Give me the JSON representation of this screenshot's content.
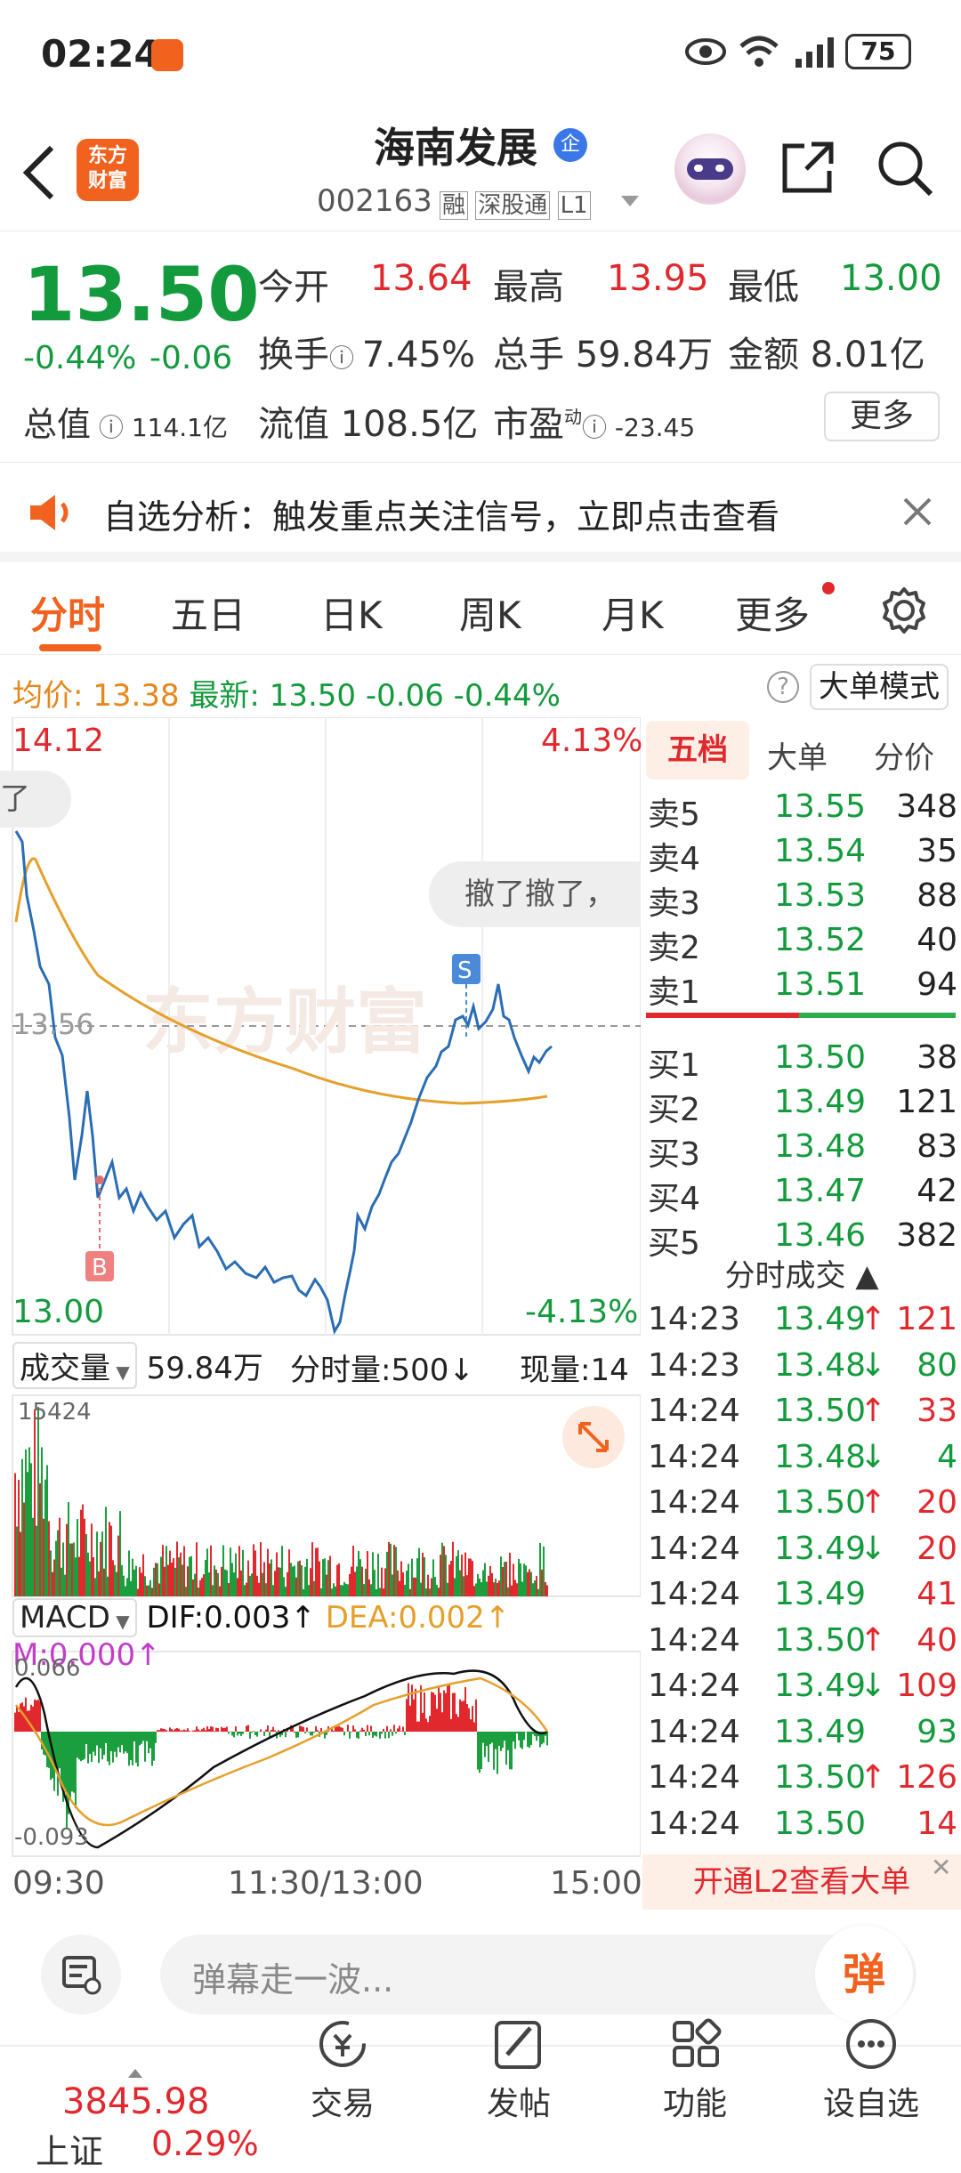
{
  "status": {
    "time": "02:24",
    "battery": "75"
  },
  "header": {
    "title": "海南发展",
    "badge": "企",
    "code": "002163",
    "tags": [
      "融",
      "深股通",
      "L1"
    ],
    "logo_top": "东方",
    "logo_bottom": "财富"
  },
  "quote": {
    "price": "13.50",
    "pct": "-0.44%",
    "chg": "-0.06",
    "open_label": "今开",
    "open": "13.64",
    "high_label": "最高",
    "high": "13.95",
    "low_label": "最低",
    "low": "13.00",
    "turnover_label": "换手",
    "turnover": "7.45%",
    "volume_label": "总手",
    "volume": "59.84万",
    "amount_label": "金额",
    "amount": "8.01亿",
    "mcap_label": "总值",
    "mcap": "114.1亿",
    "float_label": "流值",
    "float": "108.5亿",
    "pe_label": "市盈",
    "pe_sup": "动",
    "pe": "-23.45",
    "more": "更多"
  },
  "banner": {
    "text": "自选分析：触发重点关注信号，立即点击查看"
  },
  "tabs": [
    "分时",
    "五日",
    "日K",
    "周K",
    "月K",
    "更多"
  ],
  "avg": {
    "label_avg": "均价:",
    "avg": "13.38",
    "label_latest": "最新:",
    "latest": "13.50",
    "chg": "-0.06",
    "pct": "-0.44%",
    "mode": "大单模式"
  },
  "chart": {
    "y_top": "14.12",
    "y_bottom": "13.00",
    "pct_top": "4.13%",
    "pct_bottom": "-4.13%",
    "mid": "13.56",
    "watermark": "东方财富",
    "bubble1": "了",
    "bubble2": "撤了撤了，",
    "marker_s": "S",
    "marker_b": "B",
    "vol_label": "成交量",
    "vol_total": "59.84万",
    "vol_period": "分时量:500↓",
    "vol_now": "现量:14",
    "vol_max": "15424",
    "macd_label": "MACD",
    "dif": "DIF:0.003↑",
    "dea": "DEA:0.002↑",
    "m": "M:0.000↑",
    "macd_top": "0.066",
    "macd_bottom": "-0.093",
    "t1": "09:30",
    "t2": "11:30/13:00",
    "t3": "15:00"
  },
  "book": {
    "tabs": [
      "五档",
      "大单",
      "分价"
    ],
    "asks": [
      {
        "l": "卖5",
        "p": "13.55",
        "v": "348"
      },
      {
        "l": "卖4",
        "p": "13.54",
        "v": "35"
      },
      {
        "l": "卖3",
        "p": "13.53",
        "v": "88"
      },
      {
        "l": "卖2",
        "p": "13.52",
        "v": "40"
      },
      {
        "l": "卖1",
        "p": "13.51",
        "v": "94"
      }
    ],
    "bids": [
      {
        "l": "买1",
        "p": "13.50",
        "v": "38"
      },
      {
        "l": "买2",
        "p": "13.49",
        "v": "121"
      },
      {
        "l": "买3",
        "p": "13.48",
        "v": "83"
      },
      {
        "l": "买4",
        "p": "13.47",
        "v": "42"
      },
      {
        "l": "买5",
        "p": "13.46",
        "v": "382"
      }
    ],
    "trades_title": "分时成交",
    "trades": [
      {
        "t": "14:23",
        "p": "13.49",
        "d": "↑",
        "v": "121",
        "c": "r"
      },
      {
        "t": "14:23",
        "p": "13.48",
        "d": "↓",
        "v": "80",
        "c": "g"
      },
      {
        "t": "14:24",
        "p": "13.50",
        "d": "↑",
        "v": "33",
        "c": "r"
      },
      {
        "t": "14:24",
        "p": "13.48",
        "d": "↓",
        "v": "4",
        "c": "g"
      },
      {
        "t": "14:24",
        "p": "13.50",
        "d": "↑",
        "v": "20",
        "c": "r"
      },
      {
        "t": "14:24",
        "p": "13.49",
        "d": "↓",
        "v": "20",
        "c": "r"
      },
      {
        "t": "14:24",
        "p": "13.49",
        "d": "",
        "v": "41",
        "c": "r"
      },
      {
        "t": "14:24",
        "p": "13.50",
        "d": "↑",
        "v": "40",
        "c": "r"
      },
      {
        "t": "14:24",
        "p": "13.49",
        "d": "↓",
        "v": "109",
        "c": "r"
      },
      {
        "t": "14:24",
        "p": "13.49",
        "d": "",
        "v": "93",
        "c": "g"
      },
      {
        "t": "14:24",
        "p": "13.50",
        "d": "↑",
        "v": "126",
        "c": "r"
      },
      {
        "t": "14:24",
        "p": "13.50",
        "d": "",
        "v": "14",
        "c": "r"
      }
    ],
    "l2": "开通L2查看大单"
  },
  "bottom": {
    "danmu_placeholder": "弹幕走一波...",
    "danmu_btn": "弹",
    "index_value": "3845.98",
    "index_name": "上证",
    "index_pct": "0.29%",
    "nav": [
      "交易",
      "发帖",
      "功能",
      "设自选"
    ]
  }
}
